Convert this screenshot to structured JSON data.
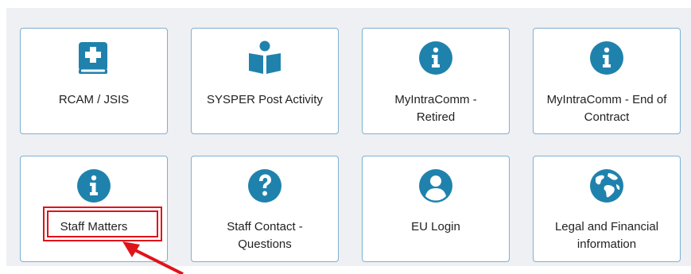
{
  "tiles": [
    {
      "label": "RCAM / JSIS",
      "icon": "medical-book-icon"
    },
    {
      "label": "SYSPER Post Activity",
      "icon": "reader-book-icon"
    },
    {
      "label": "MyIntraComm - Retired",
      "icon": "info-circle-icon"
    },
    {
      "label": "MyIntraComm - End of Contract",
      "icon": "info-circle-icon"
    },
    {
      "label": "Staff Matters",
      "icon": "info-circle-icon"
    },
    {
      "label": "Staff Contact - Questions",
      "icon": "question-circle-icon"
    },
    {
      "label": "EU Login",
      "icon": "user-circle-icon"
    },
    {
      "label": "Legal and Financial information",
      "icon": "globe-icon"
    }
  ],
  "colors": {
    "icon": "#1f82ad",
    "tile_border": "#7fb0d2",
    "highlight": "#e0131b",
    "panel_bg": "#eef0f3"
  },
  "annotation": {
    "highlighted_tile": "Staff Matters",
    "marker": "red-arrow"
  }
}
